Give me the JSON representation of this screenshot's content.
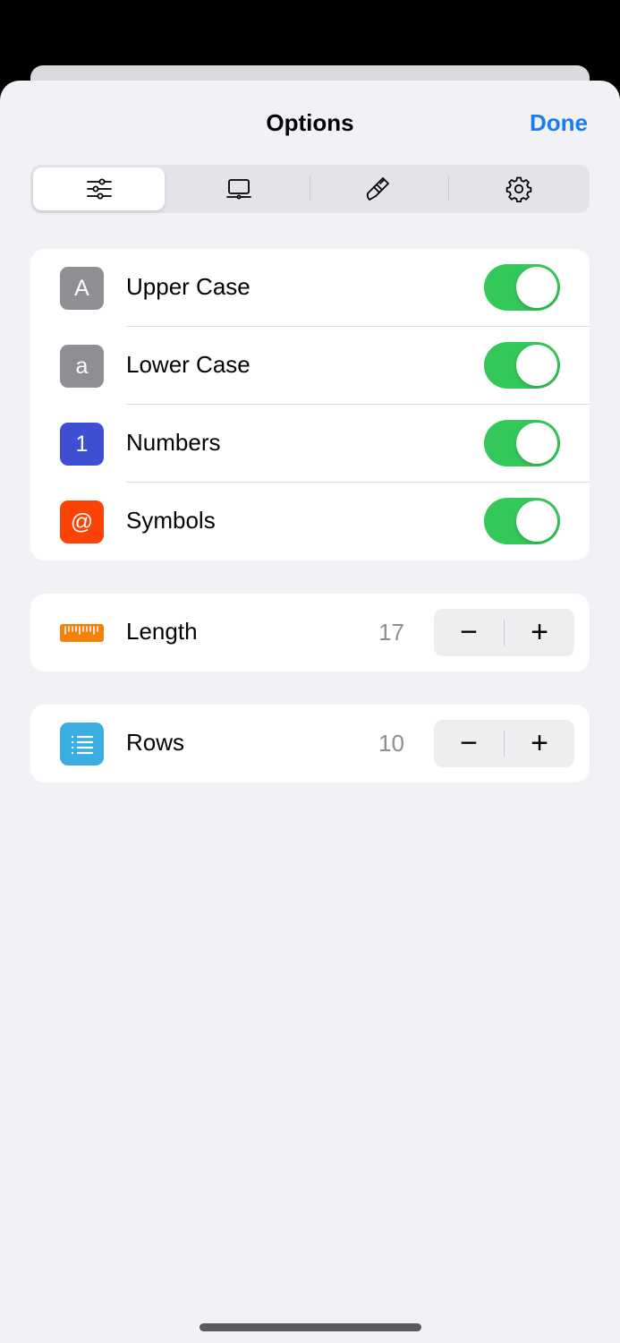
{
  "header": {
    "title": "Options",
    "done_label": "Done"
  },
  "segments": [
    {
      "icon": "sliders-icon",
      "selected": true
    },
    {
      "icon": "laptop-icon",
      "selected": false
    },
    {
      "icon": "paintbrush-icon",
      "selected": false
    },
    {
      "icon": "gear-icon",
      "selected": false
    }
  ],
  "characters": [
    {
      "glyph": "A",
      "label": "Upper Case",
      "color": "#8e8e93",
      "enabled": true
    },
    {
      "glyph": "a",
      "label": "Lower Case",
      "color": "#8e8e93",
      "enabled": true
    },
    {
      "glyph": "1",
      "label": "Numbers",
      "color": "#3f4fd3",
      "enabled": true
    },
    {
      "glyph": "@",
      "label": "Symbols",
      "color": "#fb4307",
      "enabled": true
    }
  ],
  "length": {
    "label": "Length",
    "value": "17",
    "icon": "ruler-icon",
    "color": "#f7800c",
    "minus": "−",
    "plus": "+"
  },
  "rows": {
    "label": "Rows",
    "value": "10",
    "icon": "list-icon",
    "color": "#3aaee0",
    "minus": "−",
    "plus": "+"
  }
}
